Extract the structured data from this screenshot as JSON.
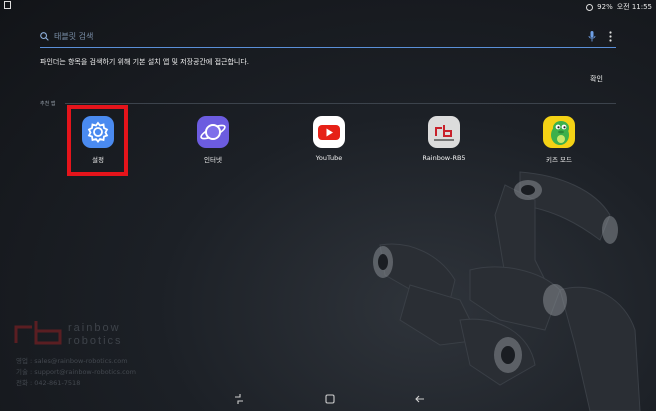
{
  "status_bar": {
    "battery": "92%",
    "time": "오전 11:55"
  },
  "search": {
    "placeholder": "태블릿 검색"
  },
  "info": {
    "message": "파인더는 항목을 검색하기 위해 기본 설치 앱 및 저장공간에 접근합니다.",
    "confirm_label": "확인"
  },
  "section": {
    "label": "추천 앱"
  },
  "apps": [
    {
      "label": "설정",
      "icon": "settings-gear-icon",
      "color": "#4a8af0"
    },
    {
      "label": "인터넷",
      "icon": "internet-planet-icon",
      "color": "#6c5ce0"
    },
    {
      "label": "YouTube",
      "icon": "youtube-play-icon",
      "color": "#e62117"
    },
    {
      "label": "Rainbow-RB5",
      "icon": "rainbow-rb-logo-icon",
      "color": "#d8d8d8"
    },
    {
      "label": "키즈 모드",
      "icon": "kids-dinosaur-icon",
      "color": "#f4d215"
    }
  ],
  "watermark": {
    "brand_line1": "rainbow",
    "brand_line2": "robotics",
    "contacts": [
      "영업 : sales@rainbow-robotics.com",
      "기술 : support@rainbow-robotics.com",
      "전화 : 042-861-7518"
    ]
  },
  "colors": {
    "accent": "#5a8fd8",
    "highlight": "#e5141b"
  }
}
